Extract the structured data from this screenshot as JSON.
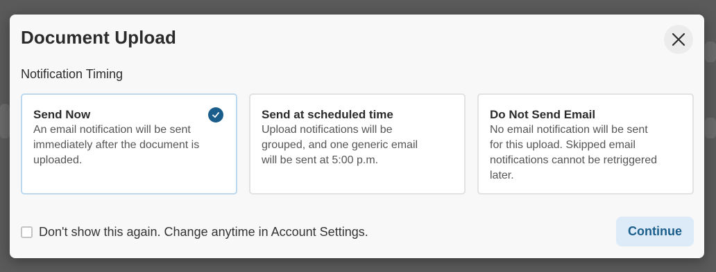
{
  "modal": {
    "title": "Document Upload",
    "close_icon": "close-icon"
  },
  "notification_timing": {
    "label": "Notification Timing",
    "selected_index": 0,
    "options": [
      {
        "title": "Send Now",
        "description": "An email notification will be sent immediately after the document is uploaded.",
        "selected": true
      },
      {
        "title": "Send at scheduled time",
        "description": "Upload notifications will be grouped, and one generic email will be sent at 5:00 p.m.",
        "selected": false
      },
      {
        "title": "Do Not Send Email",
        "description": "No email notification will be sent for this upload. Skipped email notifications cannot be retriggered later.",
        "selected": false
      }
    ]
  },
  "footer": {
    "dont_show_label": "Don't show this again. Change anytime in Account Settings.",
    "dont_show_checked": false,
    "continue_label": "Continue"
  },
  "icons": {
    "close": "close-icon",
    "selected_check": "check-circle-icon"
  },
  "colors": {
    "accent": "#1b5e8c",
    "continue_bg": "#dcebf7",
    "continue_text": "#1b5e8c",
    "selected_border": "#bcd8ee"
  }
}
